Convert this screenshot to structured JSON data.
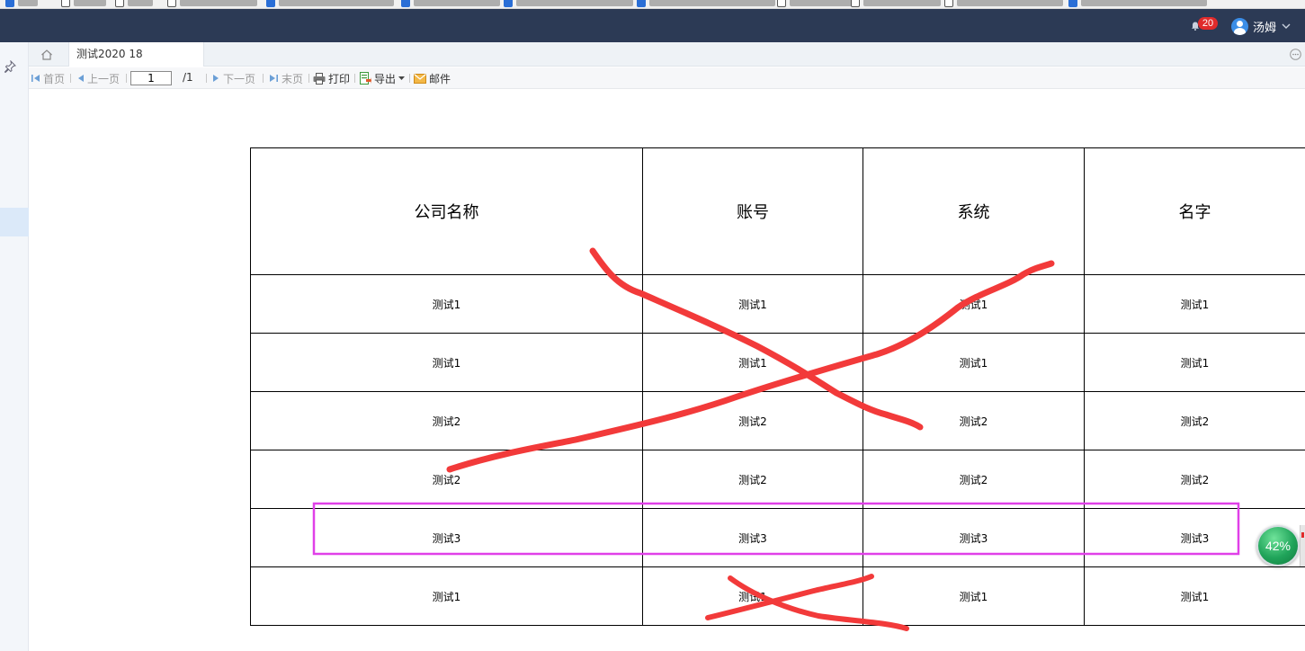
{
  "header": {
    "notification_count": "20",
    "user_name": "汤姆"
  },
  "tabs": [
    {
      "label": "测试2020 18"
    }
  ],
  "toolbar": {
    "first_page": "首页",
    "prev_page": "上一页",
    "page_input_value": "1",
    "page_total": "/1",
    "next_page": "下一页",
    "last_page": "末页",
    "print": "打印",
    "export": "导出",
    "mail": "邮件"
  },
  "report": {
    "columns": [
      "公司名称",
      "账号",
      "系统",
      "名字"
    ],
    "rows": [
      [
        "测试1",
        "测试1",
        "测试1",
        "测试1"
      ],
      [
        "测试1",
        "测试1",
        "测试1",
        "测试1"
      ],
      [
        "测试2",
        "测试2",
        "测试2",
        "测试2"
      ],
      [
        "测试2",
        "测试2",
        "测试2",
        "测试2"
      ],
      [
        "测试3",
        "测试3",
        "测试3",
        "测试3"
      ],
      [
        "测试1",
        "测试1",
        "测试1",
        "测试1"
      ]
    ]
  },
  "floating_widget": {
    "percent": "42%"
  },
  "colors": {
    "header_bg": "#2c3a55",
    "annotation_red": "#f23a3a",
    "annotation_magenta": "#e040e8",
    "badge_red": "#e02b2b",
    "widget_green": "#20a45a"
  },
  "icons": [
    "bell-icon",
    "user-avatar-icon",
    "chevron-down-icon",
    "pin-icon",
    "home-icon",
    "more-icon",
    "first-page-icon",
    "prev-page-icon",
    "next-page-icon",
    "last-page-icon",
    "print-icon",
    "export-icon",
    "mail-icon"
  ]
}
